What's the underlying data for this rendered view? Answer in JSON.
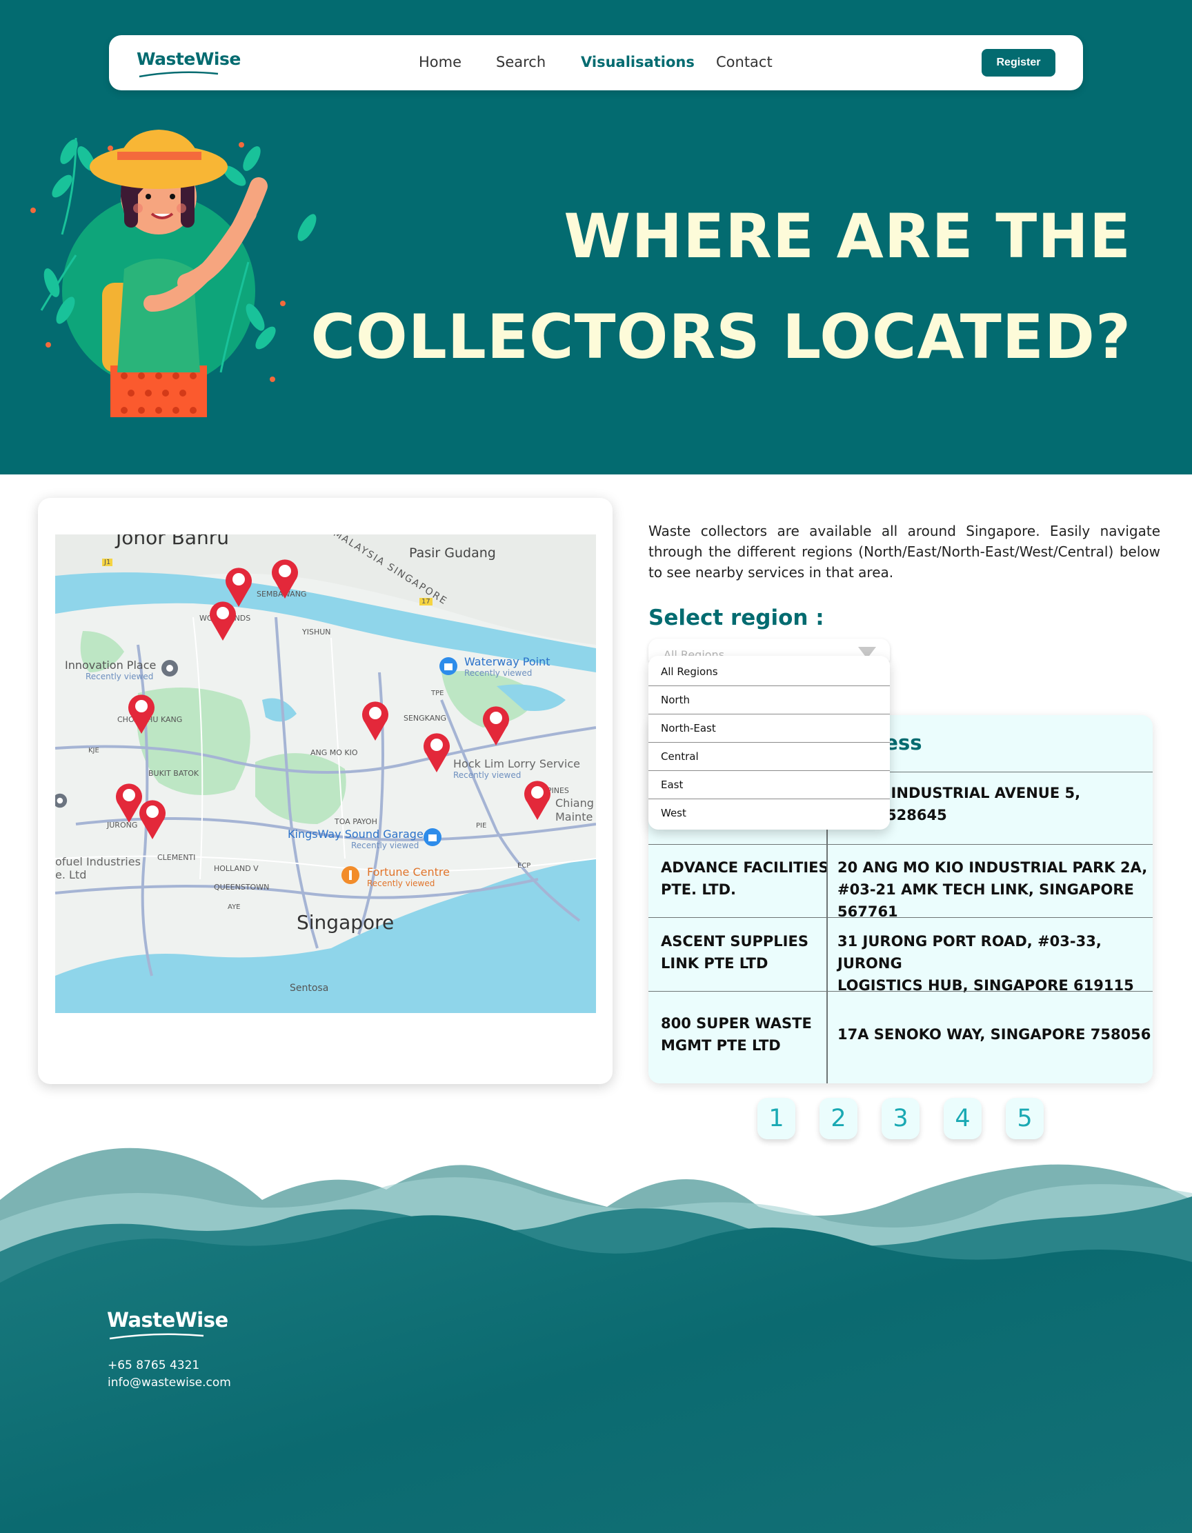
{
  "brand": {
    "name": "WasteWise"
  },
  "nav": {
    "links": [
      "Home",
      "Search",
      "Visualisations",
      "Contact"
    ],
    "active": "Visualisations",
    "register_label": "Register"
  },
  "hero": {
    "title_line1": "WHERE ARE THE",
    "title_line2": "COLLECTORS LOCATED?"
  },
  "map": {
    "labels": {
      "johor_bahru": "Johor Bahru",
      "pasir_gudang": "Pasir Gudang",
      "malaysia_singapore": "MALAYSIA SINGAPORE",
      "sembawang": "SEMBAWANG",
      "woodlands": "WOODLANDS",
      "yishun": "YISHUN",
      "innovation_place": "Innovation Place",
      "recently_viewed": "Recently viewed",
      "waterway_point": "Waterway Point",
      "sengkang": "SENGKANG",
      "choa_chu_kang": "CHOA CHU KANG",
      "ang_mo_kio": "ANG MO KIO",
      "hock_lim": "Hock Lim Lorry Service",
      "bukit_batok": "BUKIT BATOK",
      "tampines": "TAMPINES",
      "chiang": "Chiang",
      "mainte": "Mainte",
      "jurong": "JURONG",
      "toa_payoh": "TOA PAYOH",
      "kingsway": "KingsWay Sound Garage",
      "fuel_industries": "ofuel Industries",
      "fuel_ltd": "e. Ltd",
      "clementi": "CLEMENTI",
      "holland": "HOLLAND V",
      "queenstown": "QUEENSTOWN",
      "fortune_centre": "Fortune Centre",
      "singapore": "Singapore",
      "sentosa": "Sentosa",
      "pie": "PIE",
      "ecp": "ECP",
      "tpe": "TPE",
      "kje": "KJE",
      "aye": "AYE",
      "road_j1": "J1",
      "road_17": "17"
    }
  },
  "intro_text": "Waste collectors are available all around Singapore. Easily navigate through the different regions (North/East/North-East/West/Central) below to see nearby services in that area.",
  "region_select": {
    "label": "Select region :",
    "placeholder": "All Regions",
    "options": [
      "All Regions",
      "North",
      "North-East",
      "Central",
      "East",
      "West"
    ]
  },
  "table": {
    "address_header": "ress",
    "rows": [
      {
        "name": "",
        "address_line1": "PINES INDUSTRIAL AVENUE 5,",
        "address_line2": "PORE 528645"
      },
      {
        "name_line1": "ADVANCE FACILITIES",
        "name_line2": "PTE. LTD.",
        "address_line1": "20 ANG MO KIO INDUSTRIAL PARK 2A,",
        "address_line2": "#03-21 AMK TECH LINK, SINGAPORE 567761"
      },
      {
        "name_line1": "ASCENT SUPPLIES",
        "name_line2": "LINK PTE LTD",
        "address_line1": "31 JURONG PORT ROAD, #03-33, JURONG",
        "address_line2": "LOGISTICS HUB, SINGAPORE 619115"
      },
      {
        "name_line1": "800 SUPER WASTE",
        "name_line2": "MGMT PTE LTD",
        "address_line1": "17A SENOKO WAY, SINGAPORE 758056"
      }
    ]
  },
  "pagination": [
    "1",
    "2",
    "3",
    "4",
    "5"
  ],
  "footer": {
    "phone": "+65 8765 4321",
    "email": "info@wastewise.com"
  },
  "colors": {
    "primary": "#036b70",
    "hero_text": "#fdfbd9",
    "table_bg": "#ebfdfd",
    "page_number": "#1aa9b3",
    "pin": "#e3283a"
  }
}
